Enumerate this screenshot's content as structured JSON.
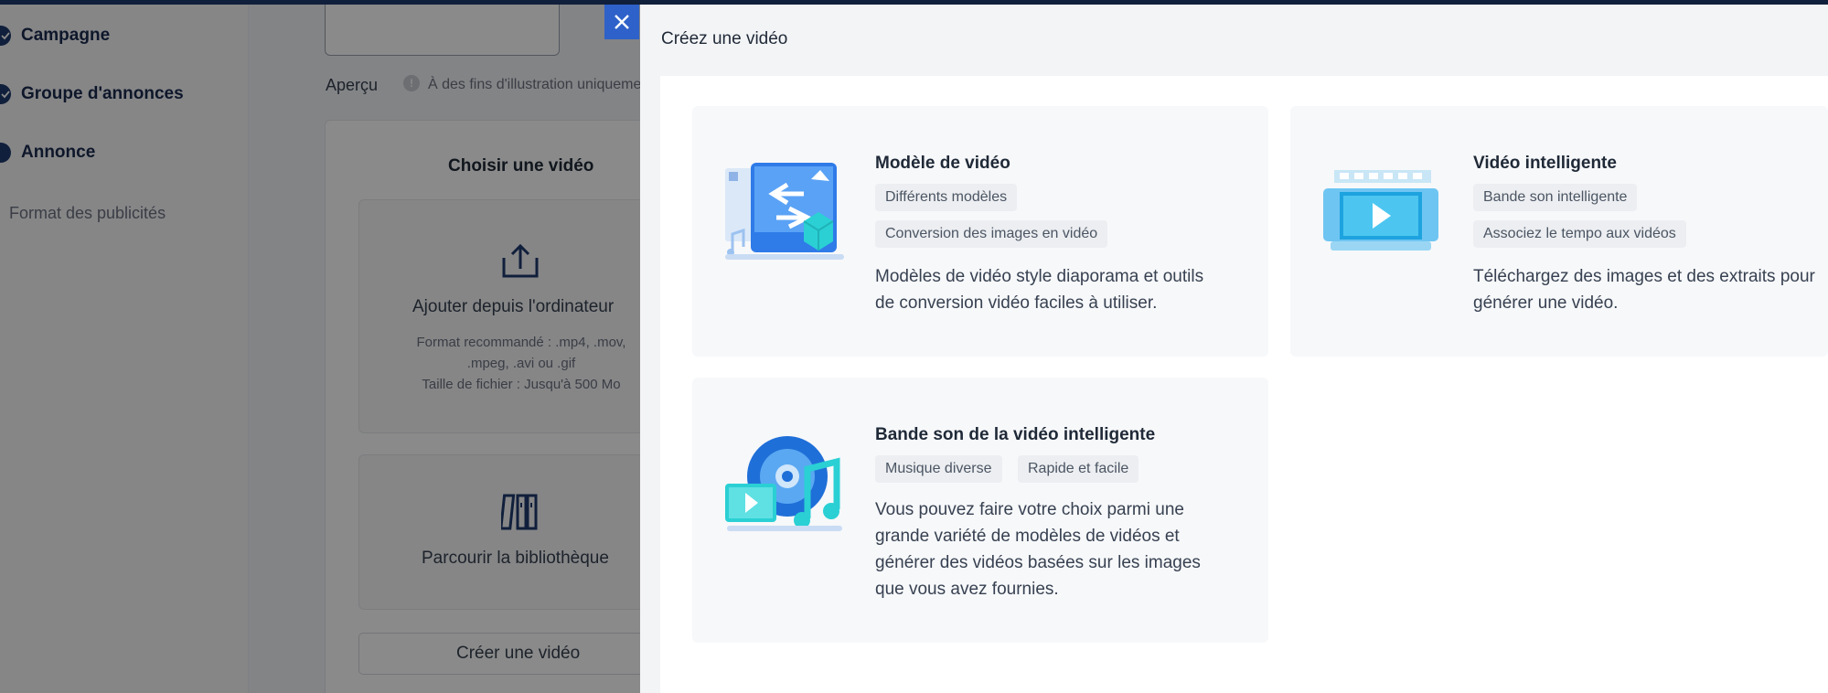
{
  "sidebar": {
    "steps": [
      {
        "label": "Campagne"
      },
      {
        "label": "Groupe d'annonces"
      },
      {
        "label": "Annonce"
      }
    ],
    "sub_item": "Format des publicités"
  },
  "main": {
    "preview_label": "Aperçu",
    "preview_hint": "À des fins d'illustration uniquement",
    "panel_title": "Choisir une vidéo",
    "upload": {
      "label": "Ajouter depuis l'ordinateur",
      "hint_line1": "Format recommandé : .mp4, .mov,",
      "hint_line2": ".mpeg, .avi ou .gif",
      "hint_line3": "Taille de fichier : Jusqu'à 500 Mo"
    },
    "library_label": "Parcourir la bibliothèque",
    "create_button": "Créer une vidéo"
  },
  "drawer": {
    "title": "Créez une vidéo",
    "cards": [
      {
        "title": "Modèle de vidéo",
        "tags": [
          "Différents modèles",
          "Conversion des images en vidéo"
        ],
        "desc_lines": [
          "Modèles de vidéo style diaporama et outils",
          "de conversion vidéo faciles à utiliser."
        ]
      },
      {
        "title": "Vidéo intelligente",
        "tags": [
          "Bande son intelligente",
          "Associez le tempo aux vidéos"
        ],
        "desc_lines": [
          "Téléchargez des images et des extraits pour",
          "générer une vidéo."
        ]
      },
      {
        "title": "Bande son de la vidéo intelligente",
        "tags": [
          "Musique diverse",
          "Rapide et facile"
        ],
        "desc_lines": [
          "Vous pouvez faire votre choix parmi une",
          "grande variété de modèles de vidéos et",
          "générer des vidéos basées sur les images",
          "que vous avez fournies."
        ]
      }
    ]
  },
  "colors": {
    "accent": "#2e61c9",
    "nav_dark": "#1f3a6e",
    "card_bg": "#f7f8fa",
    "tag_bg": "#eceef1"
  }
}
